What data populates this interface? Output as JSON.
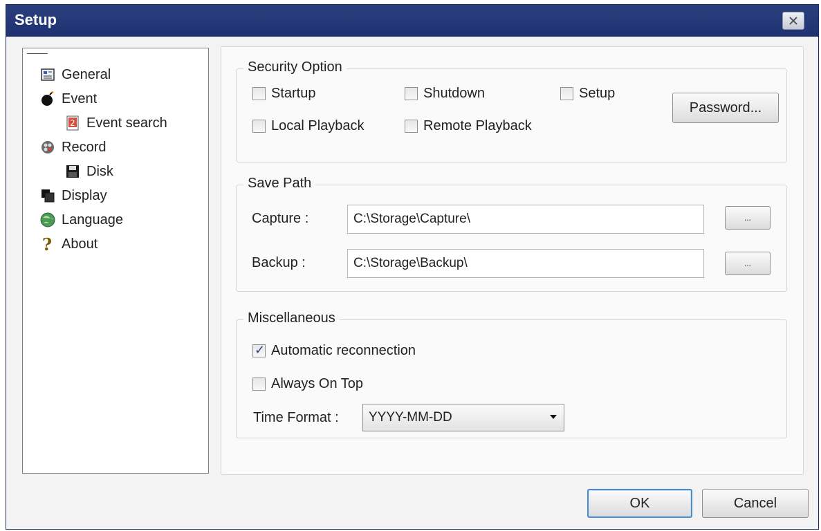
{
  "window": {
    "title": "Setup",
    "close_icon": "close-icon"
  },
  "tree": {
    "items": [
      {
        "label": "General",
        "icon": "general-icon"
      },
      {
        "label": "Event",
        "icon": "event-icon"
      },
      {
        "label": "Event search",
        "icon": "event-search-icon"
      },
      {
        "label": "Record",
        "icon": "record-icon"
      },
      {
        "label": "Disk",
        "icon": "disk-icon"
      },
      {
        "label": "Display",
        "icon": "display-icon"
      },
      {
        "label": "Language",
        "icon": "language-icon"
      },
      {
        "label": "About",
        "icon": "about-icon"
      }
    ]
  },
  "security": {
    "title": "Security Option",
    "startup": {
      "label": "Startup",
      "checked": false
    },
    "shutdown": {
      "label": "Shutdown",
      "checked": false
    },
    "setup": {
      "label": "Setup",
      "checked": false
    },
    "local_playback": {
      "label": "Local Playback",
      "checked": false
    },
    "remote_playback": {
      "label": "Remote Playback",
      "checked": false
    },
    "password_button": "Password..."
  },
  "save_path": {
    "title": "Save Path",
    "capture_label": "Capture :",
    "capture_value": "C:\\Storage\\Capture\\",
    "backup_label": "Backup :",
    "backup_value": "C:\\Storage\\Backup\\",
    "browse_label": "..."
  },
  "misc": {
    "title": "Miscellaneous",
    "auto_reconnect": {
      "label": "Automatic reconnection",
      "checked": true
    },
    "always_on_top": {
      "label": "Always On Top",
      "checked": false
    },
    "time_format_label": "Time Format :",
    "time_format_value": "YYYY-MM-DD"
  },
  "footer": {
    "ok": "OK",
    "cancel": "Cancel"
  },
  "colors": {
    "titlebar": "#233676",
    "accent": "#4b8cc7"
  }
}
